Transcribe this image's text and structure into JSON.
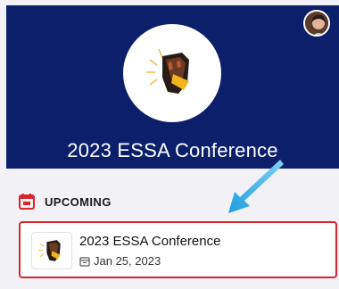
{
  "hero": {
    "title": "2023 ESSA Conference"
  },
  "section": {
    "label": "UPCOMING",
    "icon": "calendar-icon"
  },
  "event": {
    "title": "2023 ESSA Conference",
    "date": "Jan 25, 2023",
    "date_icon": "calendar-small-icon"
  },
  "colors": {
    "hero_bg": "#0b1f6b",
    "accent_red": "#d8262f",
    "arrow_blue": "#2ea8e6"
  }
}
